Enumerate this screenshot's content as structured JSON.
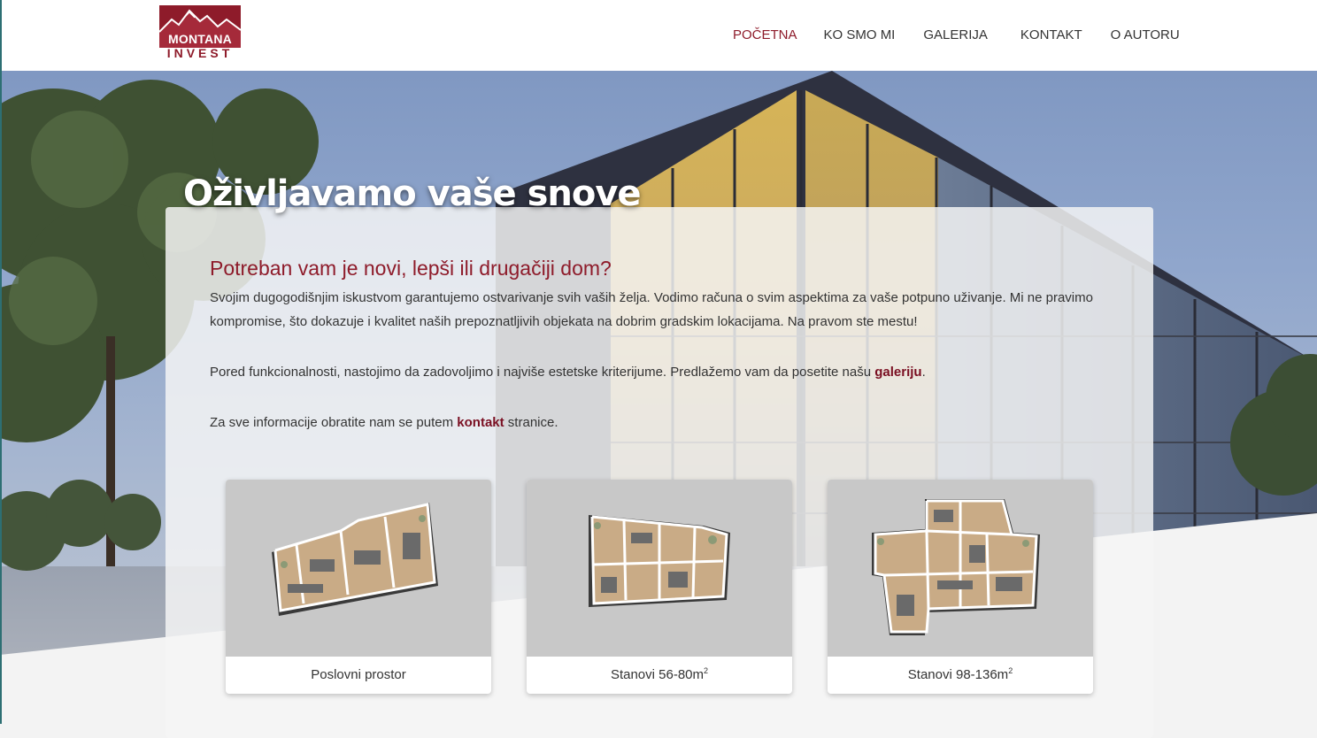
{
  "brand": {
    "logo_main": "MONTANA",
    "logo_sub": "INVEST",
    "logo_icon": "mountain-logo-icon",
    "color": "#8e1b2a"
  },
  "nav": {
    "items": [
      {
        "label": "POČETNA",
        "active": true
      },
      {
        "label": "KO SMO MI",
        "active": false
      },
      {
        "label": "GALERIJA",
        "active": false
      },
      {
        "label": "KONTAKT",
        "active": false
      },
      {
        "label": "O AUTORU",
        "active": false
      }
    ]
  },
  "hero": {
    "title": "Oživljavamo vaše snove"
  },
  "content": {
    "heading": "Potreban vam je novi, lepši ili drugačiji dom?",
    "paragraph1": "Svojim dugogodišnjim iskustvom garantujemo ostvarivanje svih vaših želja. Vodimo računa o svim aspektima za vaše potpuno uživanje. Mi ne pravimo kompromise, što dokazuje i kvalitet naših prepoznatljivih objekata na dobrim gradskim lokacijama. Na pravom ste mestu!",
    "paragraph2_before": "Pored funkcionalnosti, nastojimo da zadovoljimo i najviše estetske kriterijume. Predlažemo vam da posetite našu ",
    "paragraph2_link": "galeriju",
    "paragraph2_after": ".",
    "paragraph3_before": "Za sve informacije obratite nam se putem ",
    "paragraph3_link": "kontakt",
    "paragraph3_after": " stranice."
  },
  "cards": [
    {
      "label": "Poslovni prostor",
      "sup": ""
    },
    {
      "label": "Stanovi 56-80m",
      "sup": "2"
    },
    {
      "label": "Stanovi 98-136m",
      "sup": "2"
    }
  ]
}
